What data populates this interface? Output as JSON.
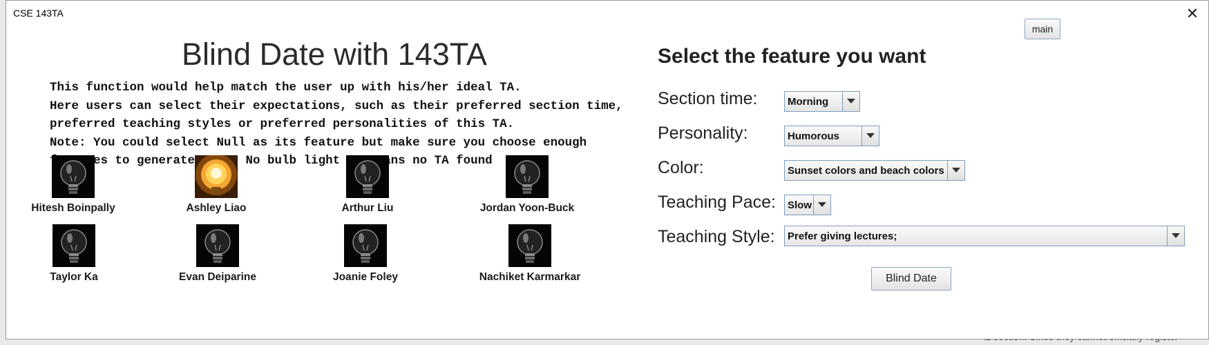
{
  "background": {
    "snippet": "lz section. Since they cannot officially register"
  },
  "window": {
    "title": "CSE 143TA",
    "close_label": "✕",
    "main_button": "main"
  },
  "left": {
    "heading": "Blind Date with 143TA",
    "description_lines": [
      "This function would help match the user up with his/her ideal TA.",
      "Here users can select their expectations, such as their preferred section time,",
      "preferred teaching styles or preferred personalities of this TA.",
      "Note: You could select Null as its feature but make sure you choose enough",
      "features to generate a TA. No bulb light up means no TA found"
    ],
    "tas": [
      {
        "name": "Hitesh Boinpally",
        "lit": false
      },
      {
        "name": "Ashley Liao",
        "lit": true
      },
      {
        "name": "Arthur Liu",
        "lit": false
      },
      {
        "name": "Jordan Yoon-Buck",
        "lit": false
      },
      {
        "name": "Taylor Ka",
        "lit": false
      },
      {
        "name": "Evan Deiparine",
        "lit": false
      },
      {
        "name": "Joanie Foley",
        "lit": false
      },
      {
        "name": "Nachiket Karmarkar",
        "lit": false
      }
    ]
  },
  "right": {
    "heading": "Select the feature you want",
    "features": [
      {
        "label": "Section time:",
        "value": "Morning"
      },
      {
        "label": "Personality:",
        "value": "Humorous"
      },
      {
        "label": "Color:",
        "value": "Sunset colors and beach colors"
      },
      {
        "label": "Teaching Pace:",
        "value": "Slow"
      },
      {
        "label": "Teaching Style:",
        "value": "Prefer giving lectures;"
      }
    ],
    "submit_label": "Blind Date"
  },
  "colors": {
    "lit_bulb": "#ffd45a",
    "unlit_bulb": "#3a3a3a",
    "combo_border": "#7f9db9"
  }
}
